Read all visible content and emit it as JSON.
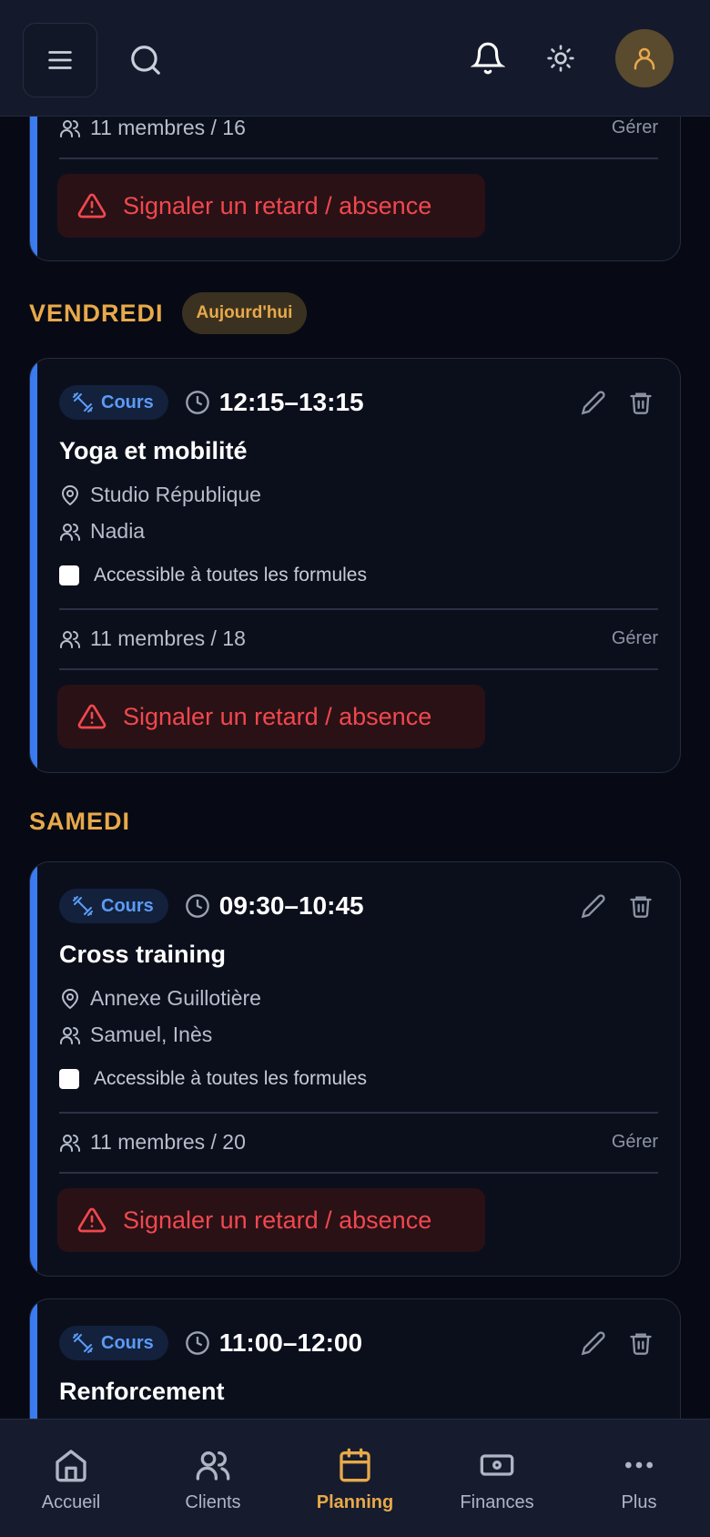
{
  "colors": {
    "accent": "#e8a94a",
    "blue": "#3b7bf0",
    "danger": "#f0484f",
    "background": "#070a14"
  },
  "header": {
    "menu_icon": "menu-icon",
    "search_icon": "search-icon",
    "bell_icon": "bell-icon",
    "theme_icon": "sun-icon",
    "avatar_icon": "user-icon"
  },
  "top_card": {
    "members": "11 membres / 16",
    "manage": "Gérer",
    "report": "Signaler un retard / absence"
  },
  "days": {
    "friday": {
      "title": "VENDREDI",
      "today": "Aujourd'hui"
    },
    "saturday": {
      "title": "SAMEDI"
    }
  },
  "sessions": [
    {
      "badge": "Cours",
      "time": "12:15–13:15",
      "title": "Yoga et mobilité",
      "location": "Studio République",
      "coach": "Nadia",
      "access": "Accessible à toutes les formules",
      "members": "11 membres / 18",
      "manage": "Gérer",
      "report": "Signaler un retard / absence"
    },
    {
      "badge": "Cours",
      "time": "09:30–10:45",
      "title": "Cross training",
      "location": "Annexe Guillotière",
      "coach": "Samuel, Inès",
      "access": "Accessible à toutes les formules",
      "members": "11 membres / 20",
      "manage": "Gérer",
      "report": "Signaler un retard / absence"
    },
    {
      "badge": "Cours",
      "time": "11:00–12:00",
      "title": "Renforcement"
    }
  ],
  "nav": [
    {
      "label": "Accueil",
      "icon": "home-icon"
    },
    {
      "label": "Clients",
      "icon": "users-icon"
    },
    {
      "label": "Planning",
      "icon": "calendar-icon",
      "active": true
    },
    {
      "label": "Finances",
      "icon": "banknote-icon"
    },
    {
      "label": "Plus",
      "icon": "more-icon"
    }
  ]
}
